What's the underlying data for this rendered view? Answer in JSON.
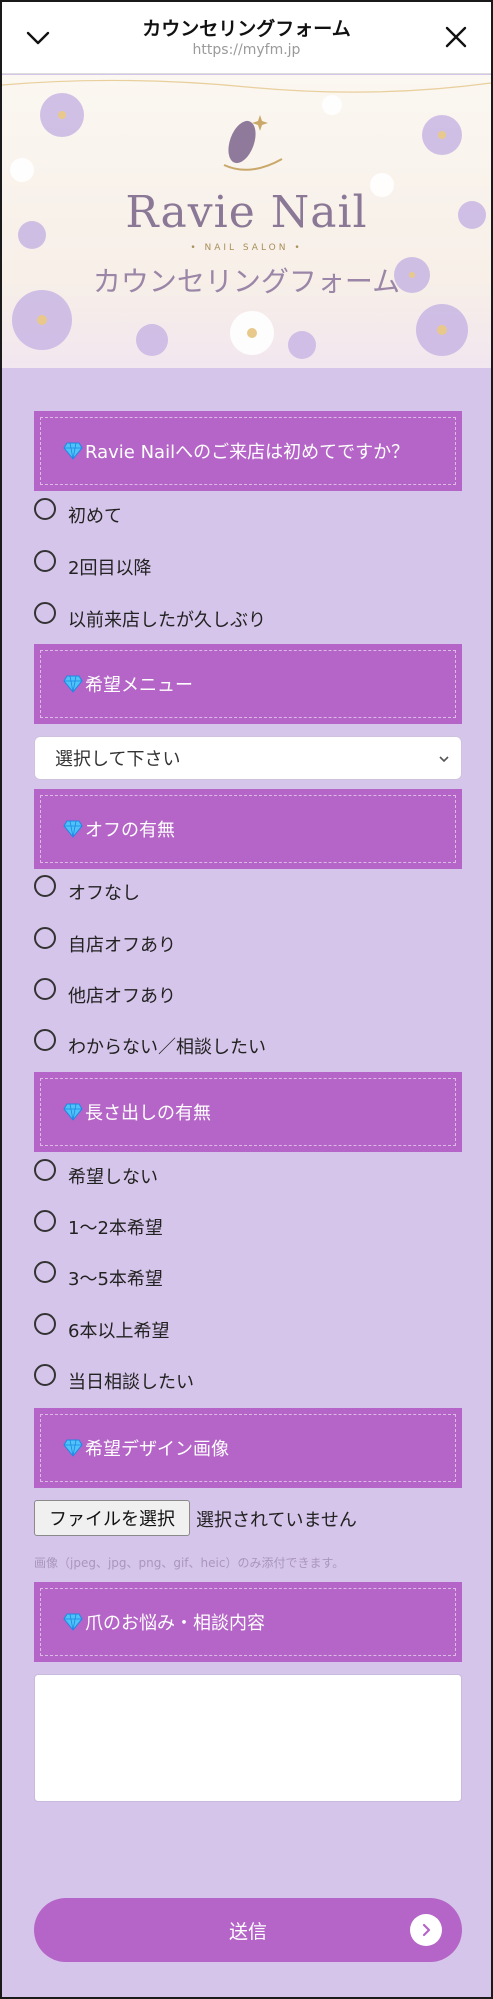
{
  "header": {
    "title": "カウンセリングフォーム",
    "url": "https://myfm.jp"
  },
  "banner": {
    "brand": "Ravie Nail",
    "tagline": "• NAIL SALON •",
    "subtitle": "カウンセリングフォーム"
  },
  "sections": {
    "first_visit": "Ravie Nailへのご来店は初めてですか？",
    "menu": "希望メニュー",
    "off": "オフの有無",
    "length": "長さ出しの有無",
    "design": "希望デザイン画像",
    "concerns": "爪のお悩み・相談内容"
  },
  "first_visit_options": [
    "初めて",
    "2回目以降",
    "以前来店したが久しぶり"
  ],
  "menu_select": {
    "value": "選択して下さい"
  },
  "off_options": [
    "オフなし",
    "自店オフあり",
    "他店オフあり",
    "わからない／相談したい"
  ],
  "length_options": [
    "希望しない",
    "1〜2本希望",
    "3〜5本希望",
    "6本以上希望",
    "当日相談したい"
  ],
  "file": {
    "button": "ファイルを選択",
    "status": "選択されていません",
    "note": "画像（jpeg、jpg、png、gif、heic）のみ添付できます。"
  },
  "submit": {
    "label": "送信"
  },
  "colors": {
    "accent": "#b565c7",
    "background": "#d6c5ea",
    "note_text": "#a996bd"
  }
}
